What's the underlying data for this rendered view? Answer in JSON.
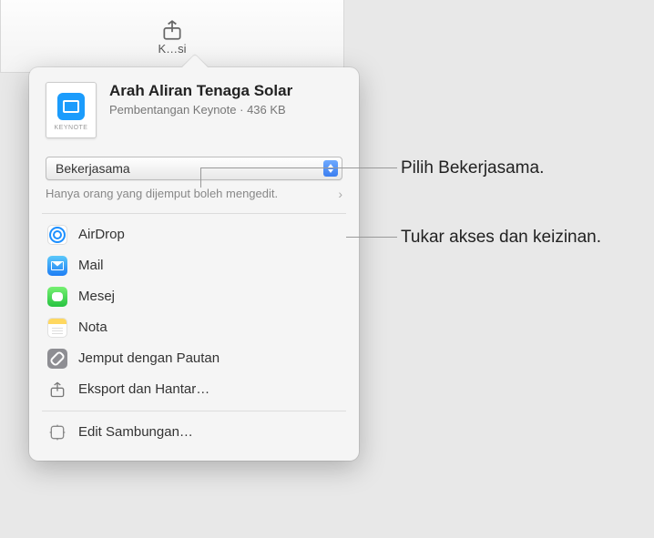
{
  "toolbar": {
    "label_partial": "K…si"
  },
  "doc": {
    "title": "Arah Aliran Tenaga Solar",
    "type": "Pembentangan Keynote",
    "size": "436 KB",
    "badge": "KEYNOTE"
  },
  "mode": {
    "selected": "Bekerjasama",
    "permission_text": "Hanya orang yang dijemput boleh mengedit."
  },
  "share_options": [
    {
      "id": "airdrop",
      "label": "AirDrop"
    },
    {
      "id": "mail",
      "label": "Mail"
    },
    {
      "id": "mesej",
      "label": "Mesej"
    },
    {
      "id": "nota",
      "label": "Nota"
    },
    {
      "id": "link",
      "label": "Jemput dengan Pautan"
    },
    {
      "id": "export",
      "label": "Eksport dan Hantar…"
    }
  ],
  "footer": {
    "edit": "Edit Sambungan…"
  },
  "callouts": {
    "collaborate": "Pilih Bekerjasama.",
    "access": "Tukar akses dan keizinan."
  }
}
